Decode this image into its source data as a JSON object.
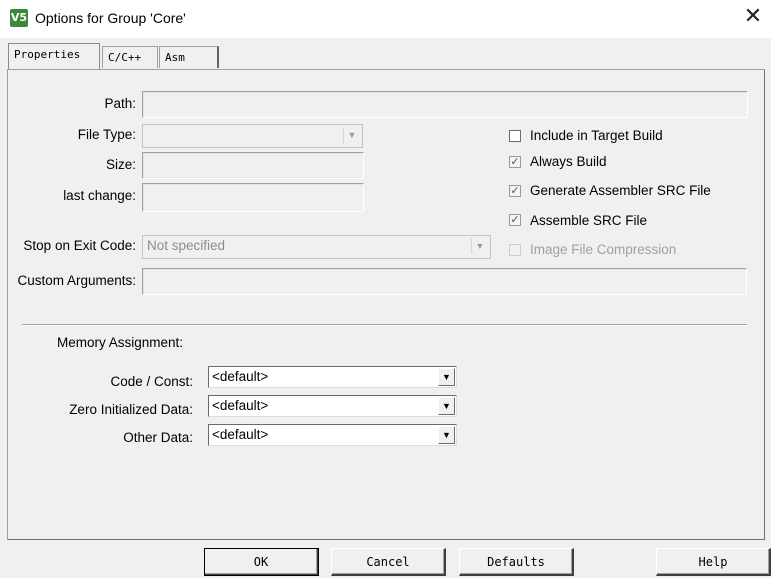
{
  "window": {
    "title": "Options for Group 'Core'",
    "app_icon_text": "V5"
  },
  "tabs": [
    {
      "label": "Properties"
    },
    {
      "label": "C/C++"
    },
    {
      "label": "Asm"
    }
  ],
  "properties": {
    "path_label": "Path:",
    "path_value": "",
    "file_type_label": "File Type:",
    "file_type_value": "",
    "size_label": "Size:",
    "size_value": "",
    "last_change_label": "last change:",
    "last_change_value": "",
    "stop_on_exit_label": "Stop on Exit Code:",
    "stop_on_exit_value": "Not specified",
    "custom_args_label": "Custom Arguments:",
    "custom_args_value": ""
  },
  "options": [
    {
      "label": "Include in Target Build",
      "checked": false,
      "enabled": true
    },
    {
      "label": "Always Build",
      "checked": true,
      "enabled": true
    },
    {
      "label": "Generate Assembler SRC File",
      "checked": true,
      "enabled": true
    },
    {
      "label": "Assemble SRC File",
      "checked": true,
      "enabled": true
    },
    {
      "label": "Image File Compression",
      "checked": false,
      "enabled": false
    }
  ],
  "memory": {
    "heading": "Memory Assignment:",
    "code_const_label": "Code / Const:",
    "code_const_value": "<default>",
    "zero_init_label": "Zero Initialized Data:",
    "zero_init_value": "<default>",
    "other_data_label": "Other Data:",
    "other_data_value": "<default>"
  },
  "buttons": {
    "ok": "OK",
    "cancel": "Cancel",
    "defaults": "Defaults",
    "help": "Help"
  },
  "icons": {
    "close": "close-icon",
    "check": "check-icon",
    "dropdown": "chevron-down-icon"
  }
}
